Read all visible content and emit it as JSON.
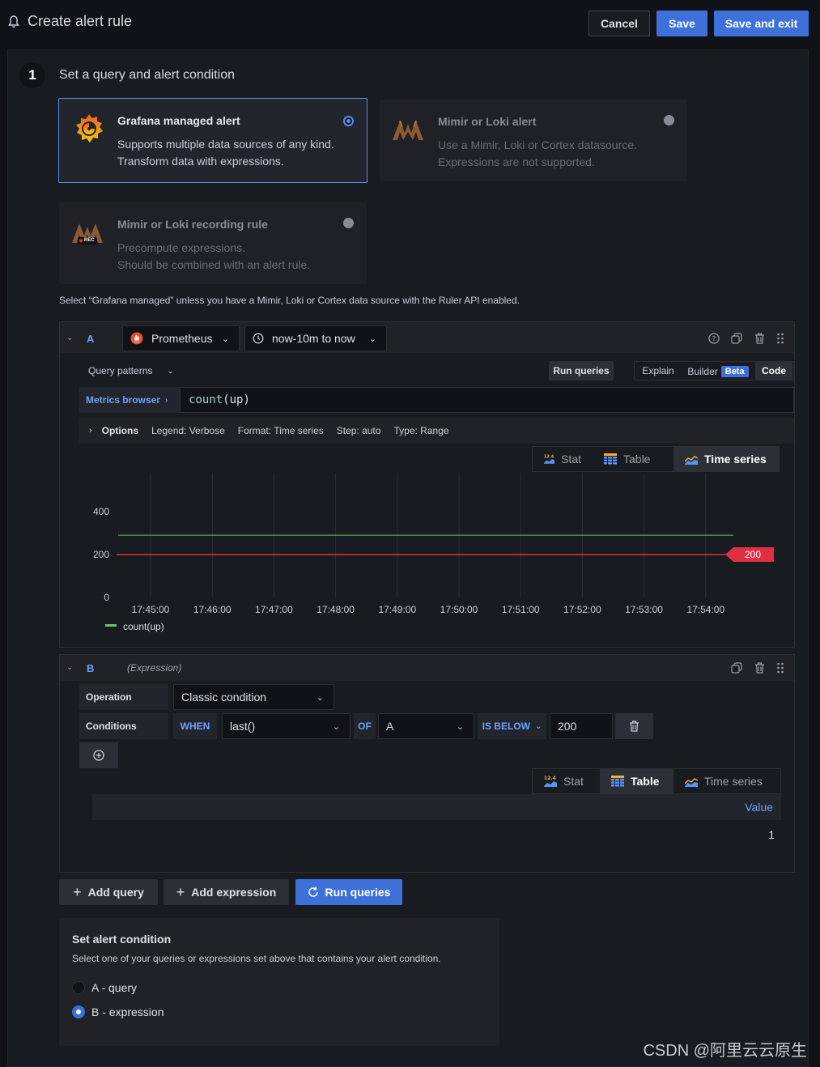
{
  "header": {
    "title": "Create alert rule",
    "cancel_label": "Cancel",
    "save_label": "Save",
    "save_exit_label": "Save and exit"
  },
  "step": {
    "number": "1",
    "title": "Set a query and alert condition"
  },
  "rule_types": [
    {
      "title": "Grafana managed alert",
      "desc_line1": "Supports multiple data sources of any kind.",
      "desc_line2": "Transform data with expressions.",
      "selected": true
    },
    {
      "title": "Mimir or Loki alert",
      "desc_line1": "Use a Mimir, Loki or Cortex datasource.",
      "desc_line2": "Expressions are not supported.",
      "selected": false
    },
    {
      "title": "Mimir or Loki recording rule",
      "desc_line1": "Precompute expressions.",
      "desc_line2": "Should be combined with an alert rule.",
      "selected": false,
      "logo_badge": "REC"
    }
  ],
  "hint": "Select “Grafana managed” unless you have a Mimir, Loki or Cortex data source with the Ruler API enabled.",
  "query_a": {
    "letter": "A",
    "datasource": "Prometheus",
    "time_range": "now-10m to now",
    "query_patterns_label": "Query patterns",
    "run_queries_label": "Run queries",
    "explain_label": "Explain",
    "builder_label": "Builder",
    "beta_label": "Beta",
    "code_label": "Code",
    "metrics_browser_label": "Metrics browser",
    "query_fn": "count",
    "query_args": "(up)",
    "options": {
      "label": "Options",
      "legend": "Legend: Verbose",
      "format": "Format: Time series",
      "step": "Step: auto",
      "type": "Type: Range"
    },
    "viz": {
      "stat": "Stat",
      "table": "Table",
      "timeseries": "Time series",
      "active": "timeseries"
    }
  },
  "chart_data": {
    "type": "line",
    "title": "",
    "x": [
      "17:45:00",
      "17:46:00",
      "17:47:00",
      "17:48:00",
      "17:49:00",
      "17:50:00",
      "17:51:00",
      "17:52:00",
      "17:53:00",
      "17:54:00"
    ],
    "yticks": [
      "400",
      "200",
      "0"
    ],
    "ylim": [
      0,
      400
    ],
    "series": [
      {
        "name": "count(up)",
        "values": [
          290,
          290,
          290,
          290,
          290,
          290,
          290,
          290,
          290,
          290
        ],
        "color": "#73bf69"
      }
    ],
    "threshold": {
      "value": 200,
      "label": "200",
      "color": "#e02f44"
    },
    "legend_placement": "bottom-left"
  },
  "expression_b": {
    "letter": "B",
    "type_label": "(Expression)",
    "operation_label": "Operation",
    "operation_value": "Classic condition",
    "conditions_label": "Conditions",
    "when_label": "WHEN",
    "reducer": "last()",
    "of_label": "OF",
    "query_ref": "A",
    "evaluator": "IS BELOW",
    "threshold": "200",
    "viz": {
      "stat": "Stat",
      "table": "Table",
      "timeseries": "Time series",
      "active": "table"
    },
    "table": {
      "column": "Value",
      "rows": [
        "1"
      ]
    }
  },
  "actions": {
    "add_query": "Add query",
    "add_expression": "Add expression",
    "run_queries": "Run queries"
  },
  "alert_condition": {
    "title": "Set alert condition",
    "desc": "Select one of your queries or expressions set above that contains your alert condition.",
    "options": [
      "A - query",
      "B - expression"
    ],
    "selected_index": 1
  },
  "watermark": "CSDN @阿里云云原生",
  "colors": {
    "primary": "#3d71d9",
    "accent_blue": "#6e9fff",
    "threshold_red": "#e02f44",
    "series_green": "#73bf69"
  }
}
